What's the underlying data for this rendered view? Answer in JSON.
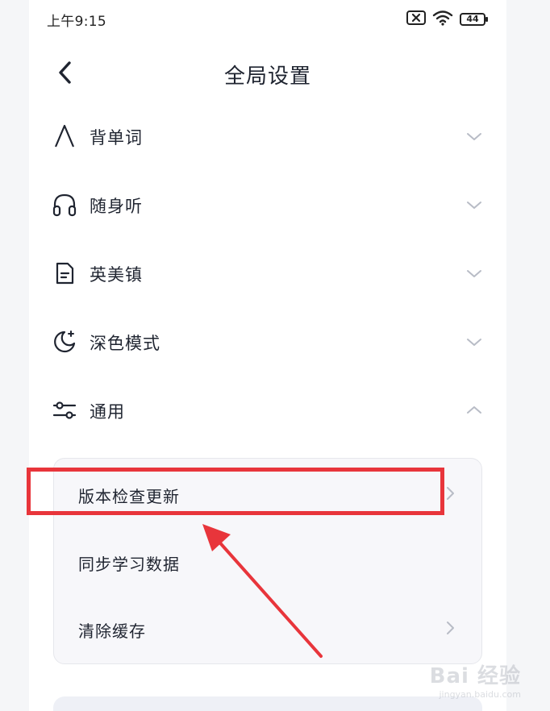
{
  "status_bar": {
    "time": "上午9:15",
    "battery": "44",
    "icons": [
      "no-sim-icon",
      "wifi-icon",
      "battery-icon"
    ]
  },
  "header": {
    "back_icon": "chevron-left-icon",
    "title": "全局设置"
  },
  "sections": [
    {
      "label": "背单词",
      "icon": "letter-a-icon",
      "expanded": false
    },
    {
      "label": "随身听",
      "icon": "headphones-icon",
      "expanded": false
    },
    {
      "label": "英美镇",
      "icon": "document-icon",
      "expanded": false
    },
    {
      "label": "深色模式",
      "icon": "moon-icon",
      "expanded": false
    },
    {
      "label": "通用",
      "icon": "sliders-icon",
      "expanded": true
    }
  ],
  "general_items": [
    {
      "label": "版本检查更新",
      "has_chevron": true
    },
    {
      "label": "同步学习数据",
      "has_chevron": false
    },
    {
      "label": "清除缓存",
      "has_chevron": true
    }
  ],
  "annotation": {
    "highlight_color": "#e8353b",
    "highlighted_item": "版本检查更新"
  },
  "watermark": {
    "logo": "Bai 经验",
    "url": "jingyan.baidu.com"
  },
  "colors": {
    "text": "#1f2430",
    "chevron": "#b8bcc6",
    "card_bg": "#f7f7fa"
  }
}
